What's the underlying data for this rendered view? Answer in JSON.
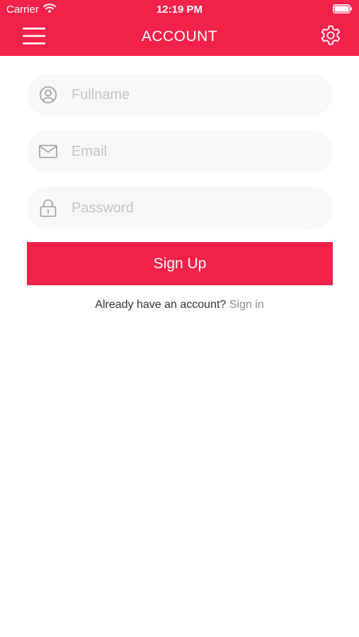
{
  "status_bar": {
    "carrier": "Carrier",
    "time": "12:19 PM",
    "icons": [
      "wifi-icon",
      "battery-icon"
    ]
  },
  "nav_bar": {
    "title": "ACCOUNT",
    "left_icon": "hamburger-menu-icon",
    "right_icon": "gear-icon"
  },
  "form": {
    "fullname": {
      "placeholder": "Fullname",
      "value": "",
      "icon": "user-circle-icon"
    },
    "email": {
      "placeholder": "Email",
      "value": "",
      "icon": "envelope-icon"
    },
    "password": {
      "placeholder": "Password",
      "value": "",
      "icon": "lock-icon"
    },
    "submit_label": "Sign Up"
  },
  "footer": {
    "prompt": "Already have an account?",
    "link": "Sign in"
  },
  "colors": {
    "accent": "#f3224b",
    "field_background": "#f8f8f8",
    "placeholder": "#c4c4c4",
    "link": "#8e8e8e"
  }
}
